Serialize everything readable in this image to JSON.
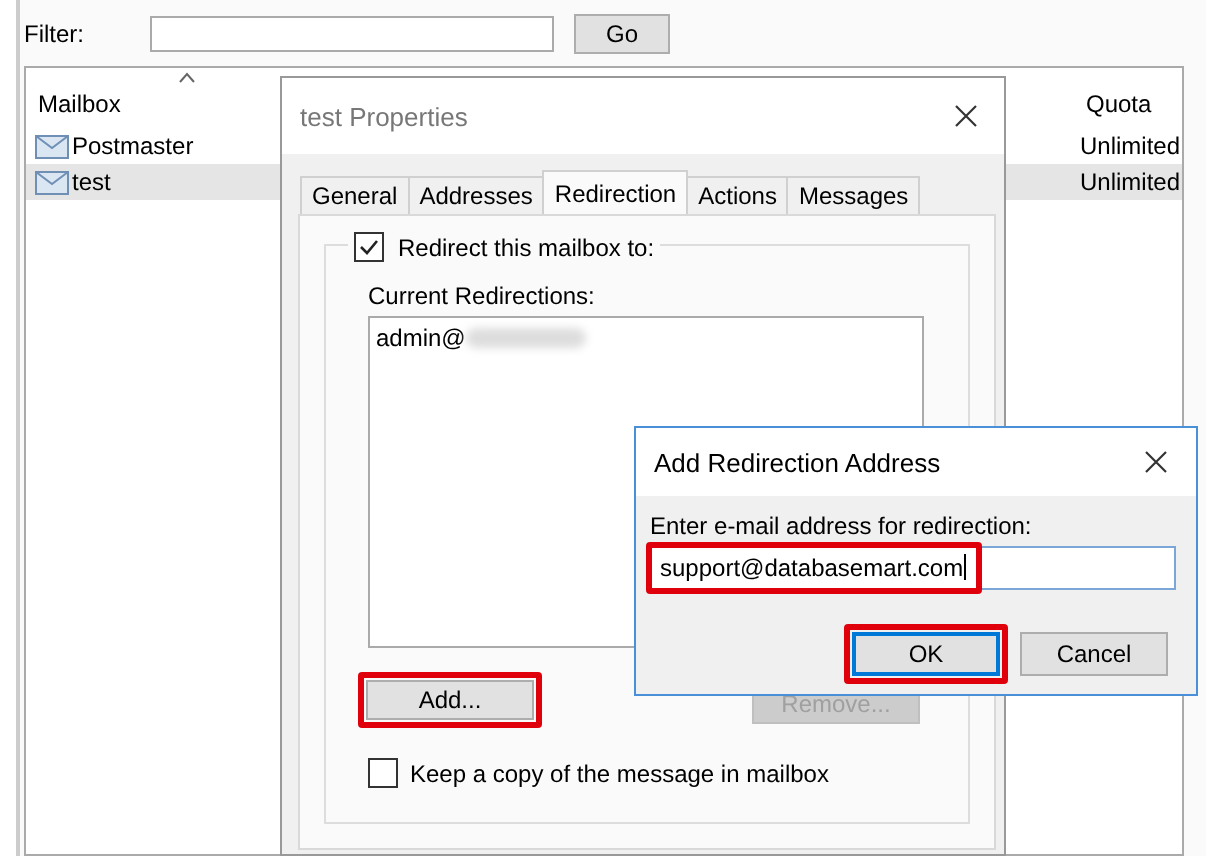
{
  "filter": {
    "label": "Filter:",
    "button": "Go"
  },
  "mailbox_list": {
    "columns": [
      "Mailbox",
      "Quota"
    ],
    "rows": [
      {
        "name": "Postmaster",
        "quota": "Unlimited",
        "selected": false
      },
      {
        "name": "test",
        "quota": "Unlimited",
        "selected": true
      }
    ]
  },
  "properties_dialog": {
    "title": "test Properties",
    "tabs": [
      {
        "label": "General",
        "selected": false
      },
      {
        "label": "Addresses",
        "selected": false
      },
      {
        "label": "Redirection",
        "selected": true
      },
      {
        "label": "Actions",
        "selected": false
      },
      {
        "label": "Messages",
        "selected": false
      }
    ],
    "redirect": {
      "label": "Redirect this mailbox to:",
      "checked": true
    },
    "current_label": "Current Redirections:",
    "redirections": [
      "admin@"
    ],
    "buttons": [
      {
        "label": "Add...",
        "disabled": false,
        "highlighted": true
      },
      {
        "label": "Remove...",
        "disabled": true,
        "highlighted": false
      }
    ],
    "keep_copy": {
      "label": "Keep a copy of the message in mailbox",
      "checked": false
    }
  },
  "add_dialog": {
    "title": "Add Redirection Address",
    "prompt": "Enter e-mail address for redirection:",
    "value": "support@databasemart.com",
    "value_highlighted": true,
    "buttons": [
      {
        "label": "OK",
        "default": true,
        "highlighted": true
      },
      {
        "label": "Cancel",
        "default": false,
        "highlighted": false
      }
    ]
  }
}
